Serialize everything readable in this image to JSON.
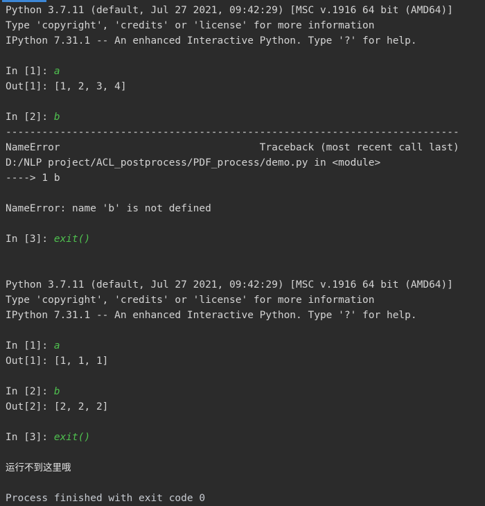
{
  "console": {
    "background_color": "#2b2b2b",
    "default_text_color": "#d4d4d4",
    "code_accent_color": "#4fc14f",
    "run_indicator_color": "#3d87d6",
    "lines": [
      {
        "id": "l1",
        "type": "text",
        "text": "Python 3.7.11 (default, Jul 27 2021, 09:42:29) [MSC v.1916 64 bit (AMD64)]"
      },
      {
        "id": "l2",
        "type": "text",
        "text": "Type 'copyright', 'credits' or 'license' for more information"
      },
      {
        "id": "l3",
        "type": "text",
        "text": "IPython 7.31.1 -- An enhanced Interactive Python. Type '?' for help."
      },
      {
        "id": "l4",
        "type": "blank",
        "text": ""
      },
      {
        "id": "l5",
        "type": "prompt",
        "prompt": "In [1]: ",
        "code": "a"
      },
      {
        "id": "l6",
        "type": "text",
        "text": "Out[1]: [1, 2, 3, 4]"
      },
      {
        "id": "l7",
        "type": "blank",
        "text": ""
      },
      {
        "id": "l8",
        "type": "prompt",
        "prompt": "In [2]: ",
        "code": "b"
      },
      {
        "id": "l9",
        "type": "text",
        "text": "---------------------------------------------------------------------------"
      },
      {
        "id": "l10",
        "type": "text",
        "text": "NameError                                 Traceback (most recent call last)"
      },
      {
        "id": "l11",
        "type": "text",
        "text": "D:/NLP project/ACL_postprocess/PDF_process/demo.py in <module>"
      },
      {
        "id": "l12",
        "type": "text",
        "text": "----> 1 b"
      },
      {
        "id": "l13",
        "type": "blank",
        "text": ""
      },
      {
        "id": "l14",
        "type": "text",
        "text": "NameError: name 'b' is not defined"
      },
      {
        "id": "l15",
        "type": "blank",
        "text": ""
      },
      {
        "id": "l16",
        "type": "prompt",
        "prompt": "In [3]: ",
        "code": "exit()"
      },
      {
        "id": "l17",
        "type": "blank",
        "text": ""
      },
      {
        "id": "l18",
        "type": "blank",
        "text": ""
      },
      {
        "id": "l19",
        "type": "text",
        "text": "Python 3.7.11 (default, Jul 27 2021, 09:42:29) [MSC v.1916 64 bit (AMD64)]"
      },
      {
        "id": "l20",
        "type": "text",
        "text": "Type 'copyright', 'credits' or 'license' for more information"
      },
      {
        "id": "l21",
        "type": "text",
        "text": "IPython 7.31.1 -- An enhanced Interactive Python. Type '?' for help."
      },
      {
        "id": "l22",
        "type": "blank",
        "text": ""
      },
      {
        "id": "l23",
        "type": "prompt",
        "prompt": "In [1]: ",
        "code": "a"
      },
      {
        "id": "l24",
        "type": "text",
        "text": "Out[1]: [1, 1, 1]"
      },
      {
        "id": "l25",
        "type": "blank",
        "text": ""
      },
      {
        "id": "l26",
        "type": "prompt",
        "prompt": "In [2]: ",
        "code": "b"
      },
      {
        "id": "l27",
        "type": "text",
        "text": "Out[2]: [2, 2, 2]"
      },
      {
        "id": "l28",
        "type": "blank",
        "text": ""
      },
      {
        "id": "l29",
        "type": "prompt",
        "prompt": "In [3]: ",
        "code": "exit()"
      },
      {
        "id": "l30",
        "type": "blank",
        "text": ""
      },
      {
        "id": "l31",
        "type": "cn",
        "text": "运行不到这里哦"
      },
      {
        "id": "l32",
        "type": "blank",
        "text": ""
      },
      {
        "id": "l33",
        "type": "proc",
        "text": "Process finished with exit code 0"
      }
    ]
  }
}
